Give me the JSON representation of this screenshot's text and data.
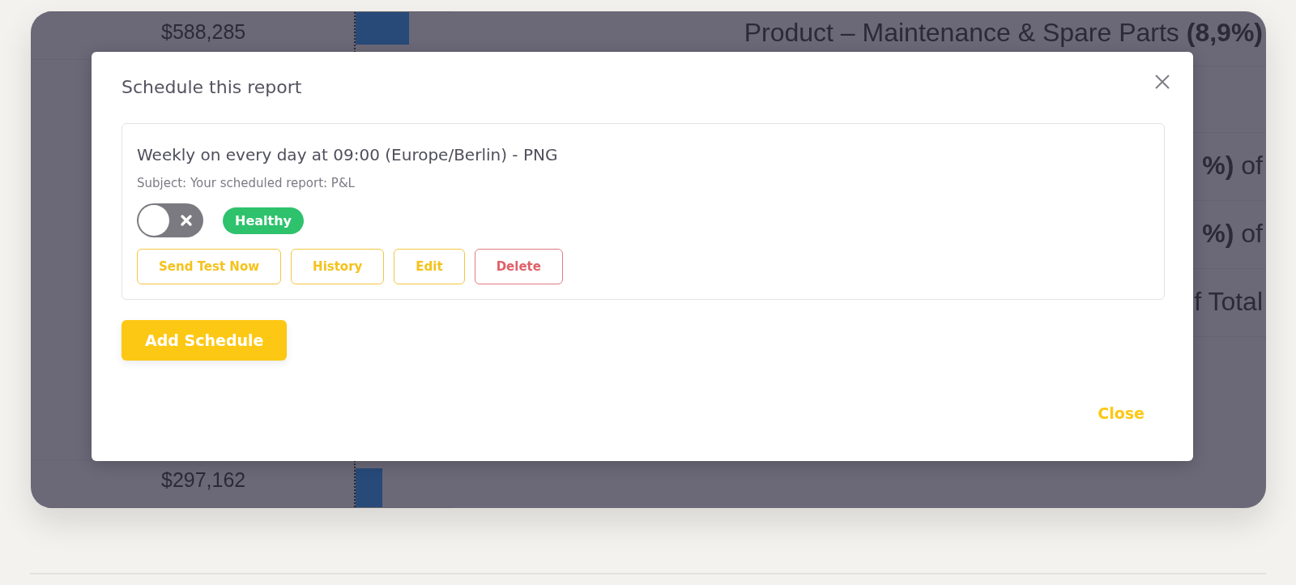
{
  "background_table": {
    "values": [
      "$588,285",
      "$297,162"
    ],
    "labels": [
      "Product – Maintenance & Spare Parts **(8,9%)**",
      "**%)** of",
      "**%)** of",
      "f Total"
    ]
  },
  "dialog": {
    "title": "Schedule this report",
    "schedules": [
      {
        "summary": "Weekly on every day at 09:00 (Europe/Berlin) - PNG",
        "subject": "Subject: Your scheduled report: P&L",
        "enabled": false,
        "status": {
          "label": "Healthy",
          "color": "#2ec26d"
        },
        "actions": [
          {
            "label": "Send Test Now",
            "kind": "default"
          },
          {
            "label": "History",
            "kind": "default"
          },
          {
            "label": "Edit",
            "kind": "default"
          },
          {
            "label": "Delete",
            "kind": "danger"
          }
        ]
      }
    ],
    "add_button": "Add Schedule",
    "close_button": "Close"
  }
}
